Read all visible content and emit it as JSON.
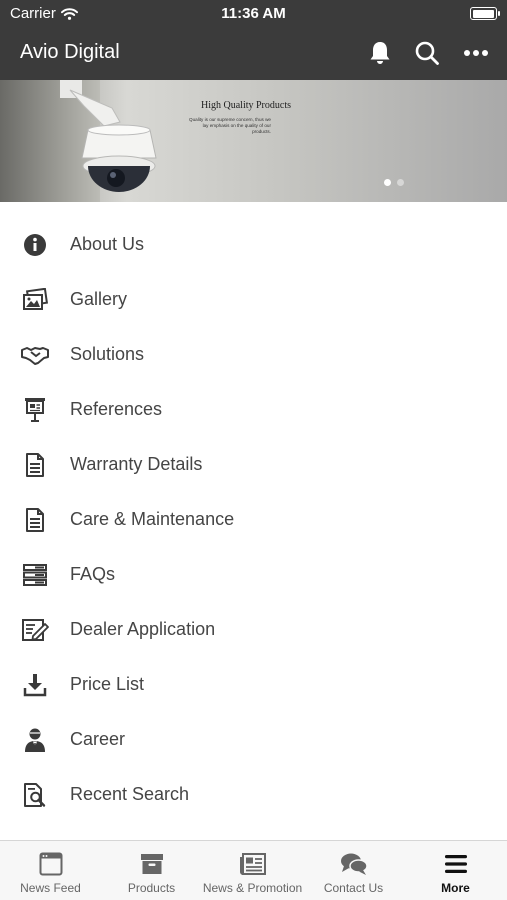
{
  "status_bar": {
    "carrier": "Carrier",
    "time": "11:36 AM",
    "battery_level": 1.0
  },
  "header": {
    "title": "Avio Digital",
    "icons": [
      "bell-icon",
      "search-icon",
      "more-icon"
    ]
  },
  "banner": {
    "heading": "High Quality Products",
    "subtext": "Quality is our supreme concern, thus we lay emphasis on the quality of our products.",
    "active_slide": 1,
    "slide_count": 2
  },
  "menu": {
    "items": [
      {
        "label": "About Us",
        "icon": "info-icon"
      },
      {
        "label": "Gallery",
        "icon": "gallery-icon"
      },
      {
        "label": "Solutions",
        "icon": "handshake-icon"
      },
      {
        "label": "References",
        "icon": "presentation-board-icon"
      },
      {
        "label": "Warranty Details",
        "icon": "document-icon"
      },
      {
        "label": "Care & Maintenance",
        "icon": "document-icon"
      },
      {
        "label": "FAQs",
        "icon": "server-list-icon"
      },
      {
        "label": "Dealer Application",
        "icon": "form-edit-icon"
      },
      {
        "label": "Price List",
        "icon": "download-icon"
      },
      {
        "label": "Career",
        "icon": "person-icon"
      },
      {
        "label": "Recent Search",
        "icon": "search-document-icon"
      }
    ]
  },
  "tabbar": {
    "tabs": [
      {
        "label": "News Feed",
        "icon": "browser-window-icon"
      },
      {
        "label": "Products",
        "icon": "archive-box-icon"
      },
      {
        "label": "News & Promotion",
        "icon": "newspaper-icon"
      },
      {
        "label": "Contact Us",
        "icon": "chat-bubbles-icon"
      },
      {
        "label": "More",
        "icon": "hamburger-menu-icon",
        "active": true
      }
    ]
  },
  "colors": {
    "header_bg": "#3b3b3b",
    "menu_text": "#454545",
    "icon": "#3a3a3a",
    "tab_text": "#666666",
    "tab_active": "#111111"
  }
}
